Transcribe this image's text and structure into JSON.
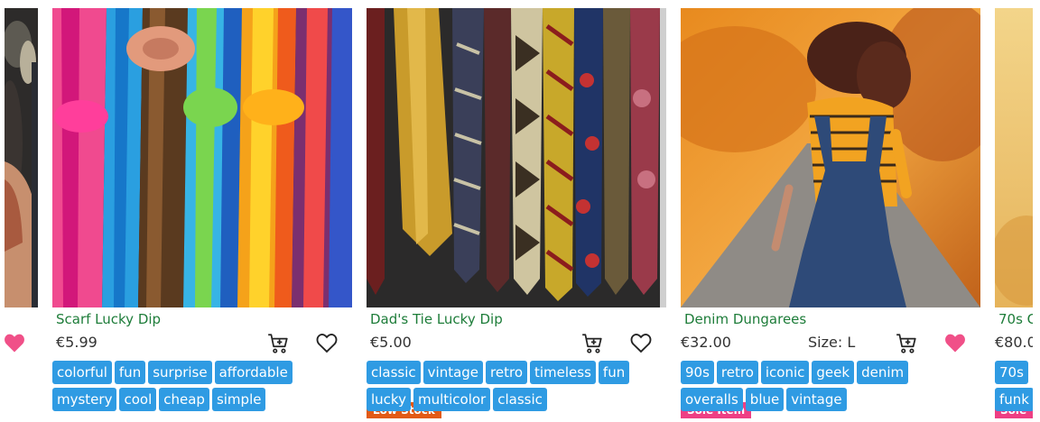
{
  "colors": {
    "accent_blue": "#2f9be3",
    "name_green": "#1e7d3a",
    "low_stock_badge": "#e25a16",
    "sole_item_badge": "#ee3f84",
    "heart_filled": "#f05088"
  },
  "left_partial": {
    "heart": "heart-filled-icon"
  },
  "products": [
    {
      "name": "Scarf Lucky Dip",
      "price": "€5.99",
      "tags": [
        "colorful",
        "fun",
        "surprise",
        "affordable",
        "mystery",
        "cool",
        "cheap",
        "simple"
      ],
      "favorited": false
    },
    {
      "name": "Dad's Tie Lucky Dip",
      "price": "€5.00",
      "badge": "Low Stock",
      "tags": [
        "classic",
        "vintage",
        "retro",
        "timeless",
        "fun",
        "lucky",
        "multicolor",
        "classic"
      ],
      "favorited": false
    },
    {
      "name": "Denim Dungarees",
      "price": "€32.00",
      "size": "Size: L",
      "badge": "Sole Item",
      "tags": [
        "90s",
        "retro",
        "iconic",
        "geek",
        "denim",
        "overalls",
        "blue",
        "vintage"
      ],
      "favorited": true
    }
  ],
  "right_partial": {
    "badge": "Sole It",
    "name": "70s C",
    "price": "€80.0",
    "tags": [
      "70s",
      "funk"
    ]
  },
  "icons": {
    "cart": "add-to-cart-icon",
    "heart_outline": "heart-outline-icon",
    "heart_filled": "heart-filled-icon"
  }
}
